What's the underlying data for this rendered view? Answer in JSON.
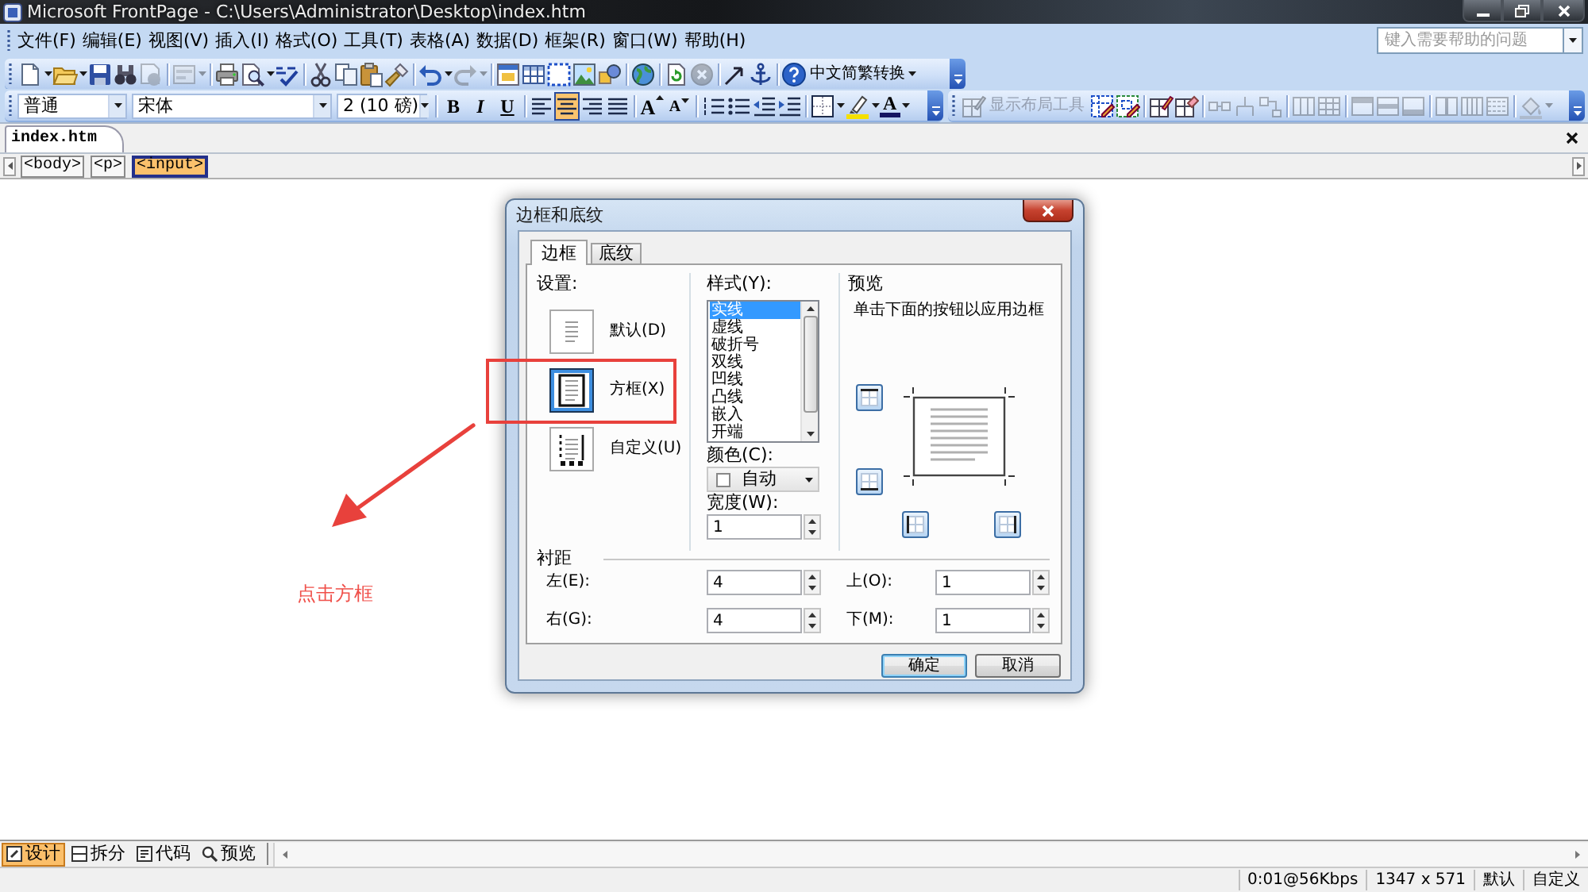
{
  "window": {
    "title": "Microsoft FrontPage - C:\\Users\\Administrator\\Desktop\\index.htm"
  },
  "menu_bar": {
    "items": [
      "文件(F)",
      "编辑(E)",
      "视图(V)",
      "插入(I)",
      "格式(O)",
      "工具(T)",
      "表格(A)",
      "数据(D)",
      "框架(R)",
      "窗口(W)",
      "帮助(H)"
    ],
    "help_search": {
      "placeholder": "键入需要帮助的问题"
    }
  },
  "standard_toolbar": {
    "buttons": [
      {
        "disabled": false
      },
      {
        "disabled": false
      },
      {
        "disabled": false
      },
      {
        "disabled": false
      },
      {
        "disabled": true
      },
      {
        "disabled": true
      },
      {
        "disabled": false
      },
      {
        "disabled": false
      },
      {
        "disabled": false
      },
      {
        "disabled": false
      },
      {
        "disabled": false
      },
      {
        "disabled": false
      },
      {
        "disabled": false
      },
      {
        "disabled": false
      },
      {
        "disabled": true
      },
      {
        "disabled": false
      },
      {
        "disabled": false
      },
      {
        "disabled": false
      },
      {
        "disabled": false
      },
      {
        "disabled": false
      },
      {
        "disabled": false
      },
      {
        "disabled": false
      },
      {
        "disabled": true
      },
      {
        "disabled": false
      },
      {
        "disabled": false
      },
      {
        "disabled": false
      }
    ],
    "convert_button": "中文简繁转换"
  },
  "formatting_toolbar": {
    "style": "普通",
    "font": "宋体",
    "size": "2 (10 磅)",
    "text_style_buttons": [
      {
        "label": "B",
        "selected": false
      },
      {
        "label": "I",
        "selected": false
      },
      {
        "label": "U",
        "selected": false
      }
    ],
    "align_buttons": [
      {
        "selected": false
      },
      {
        "selected": true
      },
      {
        "selected": false
      },
      {
        "selected": false
      }
    ],
    "font_size_buttons": [
      {
        "label": "A"
      },
      {
        "label": "A"
      }
    ],
    "font_color_button": {
      "label": "A"
    }
  },
  "layout_toolbar": {
    "label": "显示布局工具",
    "disabled": true,
    "buttons": [
      {
        "disabled": false
      },
      {
        "disabled": false
      },
      {
        "disabled": false
      },
      {
        "disabled": false
      },
      {
        "disabled": true
      },
      {
        "disabled": true
      },
      {
        "disabled": true
      },
      {
        "disabled": true
      },
      {
        "disabled": true
      },
      {
        "disabled": true
      },
      {
        "disabled": true
      },
      {
        "disabled": true
      },
      {
        "disabled": true
      },
      {
        "disabled": true
      },
      {
        "disabled": true
      },
      {
        "disabled": true
      }
    ]
  },
  "document_tabs": [
    {
      "label": "index.htm",
      "selected": true
    }
  ],
  "tag_path": [
    {
      "label": "<body>",
      "selected": false
    },
    {
      "label": "<p>",
      "selected": false
    },
    {
      "label": "<input>",
      "selected": true
    }
  ],
  "dialog": {
    "title": "边框和底纹",
    "tabs": [
      {
        "label": "边框",
        "selected": true
      },
      {
        "label": "底纹",
        "selected": false
      }
    ],
    "settings": {
      "label": "设置:",
      "options": [
        {
          "label": "默认(D)",
          "selected": false
        },
        {
          "label": "方框(X)",
          "selected": true
        },
        {
          "label": "自定义(U)",
          "selected": false
        }
      ]
    },
    "style": {
      "label": "样式(Y):",
      "items": [
        {
          "label": "实线",
          "selected": true
        },
        {
          "label": "虚线",
          "selected": false
        },
        {
          "label": "破折号",
          "selected": false
        },
        {
          "label": "双线",
          "selected": false
        },
        {
          "label": "凹线",
          "selected": false
        },
        {
          "label": "凸线",
          "selected": false
        },
        {
          "label": "嵌入",
          "selected": false
        },
        {
          "label": "开端",
          "selected": false
        }
      ]
    },
    "color": {
      "label": "颜色(C):",
      "value": "自动"
    },
    "width": {
      "label": "宽度(W):",
      "value": "1"
    },
    "preview": {
      "label": "预览",
      "hint": "单击下面的按钮以应用边框"
    },
    "padding": {
      "label": "衬距",
      "fields": [
        {
          "label": "左(E):",
          "value": "4"
        },
        {
          "label": "上(O):",
          "value": "1"
        },
        {
          "label": "右(G):",
          "value": "4"
        },
        {
          "label": "下(M):",
          "value": "1"
        }
      ]
    },
    "buttons": [
      {
        "label": "确定",
        "default": true
      },
      {
        "label": "取消",
        "default": false
      }
    ]
  },
  "annotation": {
    "text": "点击方框"
  },
  "view_tabs": [
    {
      "label": "设计",
      "selected": true
    },
    {
      "label": "拆分",
      "selected": false
    },
    {
      "label": "代码",
      "selected": false
    },
    {
      "label": "预览",
      "selected": false
    }
  ],
  "status_bar": {
    "items": [
      "0:01@56Kbps",
      "1347 x 571",
      "默认",
      "自定义"
    ]
  }
}
